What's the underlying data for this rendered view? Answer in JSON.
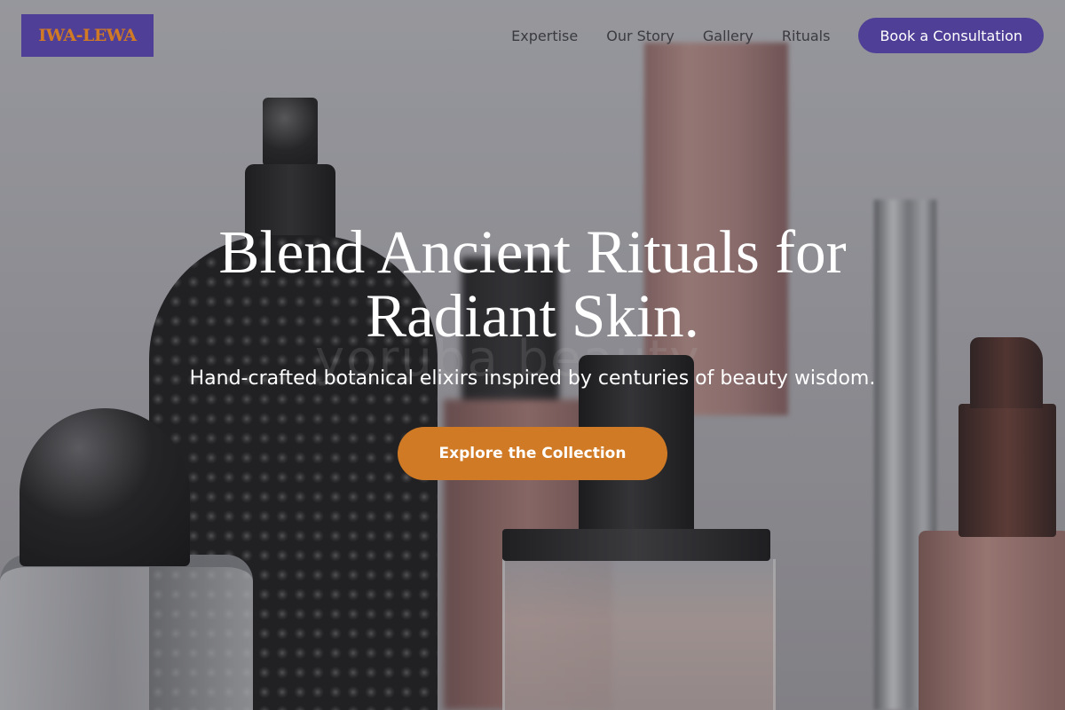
{
  "brand": {
    "logo_text": "IWA-LEWA",
    "primary_color": "#4f3f97",
    "accent_color": "#d07a25"
  },
  "nav": {
    "links": [
      {
        "label": "Expertise"
      },
      {
        "label": "Our Story"
      },
      {
        "label": "Gallery"
      },
      {
        "label": "Rituals"
      }
    ],
    "cta_label": "Book a Consultation"
  },
  "hero": {
    "headline": "Blend Ancient Rituals for Radiant Skin.",
    "subheadline": "Hand-crafted botanical elixirs inspired by centuries of beauty wisdom.",
    "cta_label": "Explore the Collection",
    "background_watermark": "yoruba beauty"
  }
}
